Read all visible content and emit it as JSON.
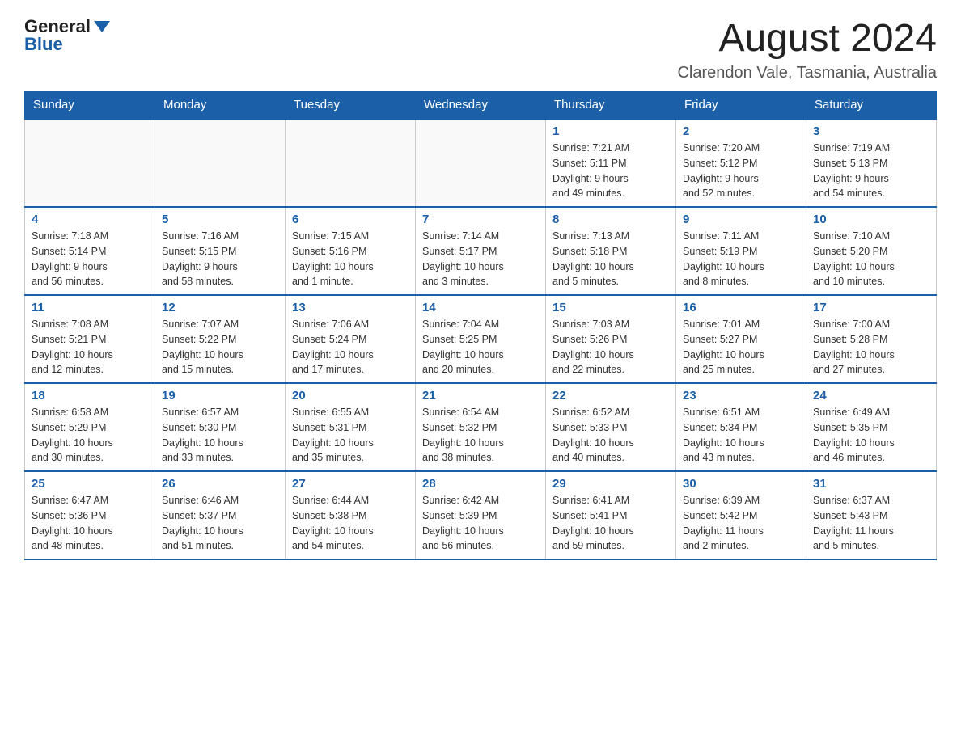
{
  "header": {
    "logo_general": "General",
    "logo_blue": "Blue",
    "title": "August 2024",
    "subtitle": "Clarendon Vale, Tasmania, Australia"
  },
  "calendar": {
    "days_of_week": [
      "Sunday",
      "Monday",
      "Tuesday",
      "Wednesday",
      "Thursday",
      "Friday",
      "Saturday"
    ],
    "weeks": [
      [
        {
          "day": "",
          "info": ""
        },
        {
          "day": "",
          "info": ""
        },
        {
          "day": "",
          "info": ""
        },
        {
          "day": "",
          "info": ""
        },
        {
          "day": "1",
          "info": "Sunrise: 7:21 AM\nSunset: 5:11 PM\nDaylight: 9 hours\nand 49 minutes."
        },
        {
          "day": "2",
          "info": "Sunrise: 7:20 AM\nSunset: 5:12 PM\nDaylight: 9 hours\nand 52 minutes."
        },
        {
          "day": "3",
          "info": "Sunrise: 7:19 AM\nSunset: 5:13 PM\nDaylight: 9 hours\nand 54 minutes."
        }
      ],
      [
        {
          "day": "4",
          "info": "Sunrise: 7:18 AM\nSunset: 5:14 PM\nDaylight: 9 hours\nand 56 minutes."
        },
        {
          "day": "5",
          "info": "Sunrise: 7:16 AM\nSunset: 5:15 PM\nDaylight: 9 hours\nand 58 minutes."
        },
        {
          "day": "6",
          "info": "Sunrise: 7:15 AM\nSunset: 5:16 PM\nDaylight: 10 hours\nand 1 minute."
        },
        {
          "day": "7",
          "info": "Sunrise: 7:14 AM\nSunset: 5:17 PM\nDaylight: 10 hours\nand 3 minutes."
        },
        {
          "day": "8",
          "info": "Sunrise: 7:13 AM\nSunset: 5:18 PM\nDaylight: 10 hours\nand 5 minutes."
        },
        {
          "day": "9",
          "info": "Sunrise: 7:11 AM\nSunset: 5:19 PM\nDaylight: 10 hours\nand 8 minutes."
        },
        {
          "day": "10",
          "info": "Sunrise: 7:10 AM\nSunset: 5:20 PM\nDaylight: 10 hours\nand 10 minutes."
        }
      ],
      [
        {
          "day": "11",
          "info": "Sunrise: 7:08 AM\nSunset: 5:21 PM\nDaylight: 10 hours\nand 12 minutes."
        },
        {
          "day": "12",
          "info": "Sunrise: 7:07 AM\nSunset: 5:22 PM\nDaylight: 10 hours\nand 15 minutes."
        },
        {
          "day": "13",
          "info": "Sunrise: 7:06 AM\nSunset: 5:24 PM\nDaylight: 10 hours\nand 17 minutes."
        },
        {
          "day": "14",
          "info": "Sunrise: 7:04 AM\nSunset: 5:25 PM\nDaylight: 10 hours\nand 20 minutes."
        },
        {
          "day": "15",
          "info": "Sunrise: 7:03 AM\nSunset: 5:26 PM\nDaylight: 10 hours\nand 22 minutes."
        },
        {
          "day": "16",
          "info": "Sunrise: 7:01 AM\nSunset: 5:27 PM\nDaylight: 10 hours\nand 25 minutes."
        },
        {
          "day": "17",
          "info": "Sunrise: 7:00 AM\nSunset: 5:28 PM\nDaylight: 10 hours\nand 27 minutes."
        }
      ],
      [
        {
          "day": "18",
          "info": "Sunrise: 6:58 AM\nSunset: 5:29 PM\nDaylight: 10 hours\nand 30 minutes."
        },
        {
          "day": "19",
          "info": "Sunrise: 6:57 AM\nSunset: 5:30 PM\nDaylight: 10 hours\nand 33 minutes."
        },
        {
          "day": "20",
          "info": "Sunrise: 6:55 AM\nSunset: 5:31 PM\nDaylight: 10 hours\nand 35 minutes."
        },
        {
          "day": "21",
          "info": "Sunrise: 6:54 AM\nSunset: 5:32 PM\nDaylight: 10 hours\nand 38 minutes."
        },
        {
          "day": "22",
          "info": "Sunrise: 6:52 AM\nSunset: 5:33 PM\nDaylight: 10 hours\nand 40 minutes."
        },
        {
          "day": "23",
          "info": "Sunrise: 6:51 AM\nSunset: 5:34 PM\nDaylight: 10 hours\nand 43 minutes."
        },
        {
          "day": "24",
          "info": "Sunrise: 6:49 AM\nSunset: 5:35 PM\nDaylight: 10 hours\nand 46 minutes."
        }
      ],
      [
        {
          "day": "25",
          "info": "Sunrise: 6:47 AM\nSunset: 5:36 PM\nDaylight: 10 hours\nand 48 minutes."
        },
        {
          "day": "26",
          "info": "Sunrise: 6:46 AM\nSunset: 5:37 PM\nDaylight: 10 hours\nand 51 minutes."
        },
        {
          "day": "27",
          "info": "Sunrise: 6:44 AM\nSunset: 5:38 PM\nDaylight: 10 hours\nand 54 minutes."
        },
        {
          "day": "28",
          "info": "Sunrise: 6:42 AM\nSunset: 5:39 PM\nDaylight: 10 hours\nand 56 minutes."
        },
        {
          "day": "29",
          "info": "Sunrise: 6:41 AM\nSunset: 5:41 PM\nDaylight: 10 hours\nand 59 minutes."
        },
        {
          "day": "30",
          "info": "Sunrise: 6:39 AM\nSunset: 5:42 PM\nDaylight: 11 hours\nand 2 minutes."
        },
        {
          "day": "31",
          "info": "Sunrise: 6:37 AM\nSunset: 5:43 PM\nDaylight: 11 hours\nand 5 minutes."
        }
      ]
    ]
  }
}
